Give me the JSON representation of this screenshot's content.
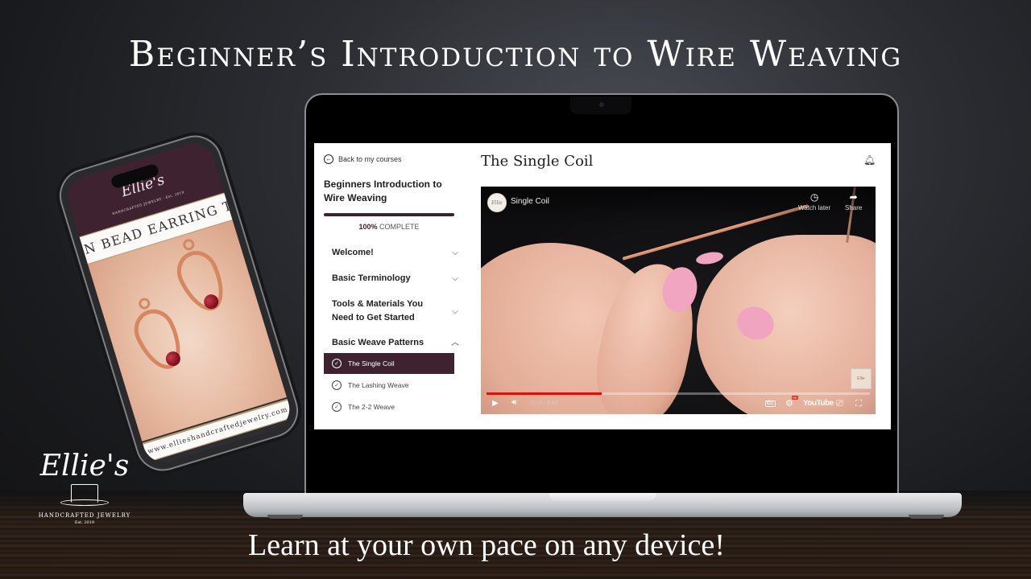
{
  "promo": {
    "headline": "Beginner’s Introduction to Wire Weaving",
    "tagline": "Learn at your own pace on any device!"
  },
  "brand": {
    "script_name": "Ellie's",
    "tagline": "HANDCRAFTED JEWELRY",
    "established": "Est. 2019"
  },
  "phone": {
    "logo": "Ellie's",
    "logo_sub": "HANDCRAFTED JEWELRY · Est. 2019",
    "banner_text": "EN BEAD EARRING TUTO",
    "footer_url": "www.ellieshandcraftedjewelry.com"
  },
  "course_app": {
    "back_link": "Back to my courses",
    "course_title": "Beginners Introduction to Wire Weaving",
    "progress": {
      "percent": 100,
      "percent_label": "100%",
      "suffix": "COMPLETE"
    },
    "sections": [
      {
        "label": "Welcome!",
        "expanded": false,
        "chevron": "⌵"
      },
      {
        "label": "Basic Terminology",
        "expanded": false,
        "chevron": "⌵"
      },
      {
        "label": "Tools & Materials You Need to Get Started",
        "expanded": false,
        "chevron": "⌵"
      },
      {
        "label": "Basic Weave Patterns",
        "expanded": true,
        "chevron": "^"
      }
    ],
    "lessons": [
      {
        "label": "The Single Coil",
        "active": true,
        "icon": "✓"
      },
      {
        "label": "The Lashing Weave",
        "active": false,
        "icon": "✓"
      },
      {
        "label": "The 2-2 Weave",
        "active": false,
        "icon": "✓"
      }
    ],
    "lesson_title": "The Single Coil",
    "notification_icon": "🔔︎",
    "accent_color": "#3e2230"
  },
  "video_player": {
    "title": "Single Coil",
    "channel_avatar_text": "Ellie",
    "watch_later_label": "Watch later",
    "share_label": "Share",
    "watch_later_icon": "◷",
    "share_icon": "➦",
    "current_time": "0:13",
    "duration": "0:43",
    "time_display": "0:13 / 0:43",
    "progress_fraction": 0.3,
    "play_icon": "▶",
    "volume_icon": "🔊︎",
    "cc_label": "CC",
    "settings_icon": "⚙",
    "hd_badge": "HD",
    "youtube_label": "YouTube",
    "cast_icon": "⎚",
    "fullscreen_icon": "⛶",
    "watermark_text": "Ellie",
    "progress_color": "#ff0000"
  }
}
